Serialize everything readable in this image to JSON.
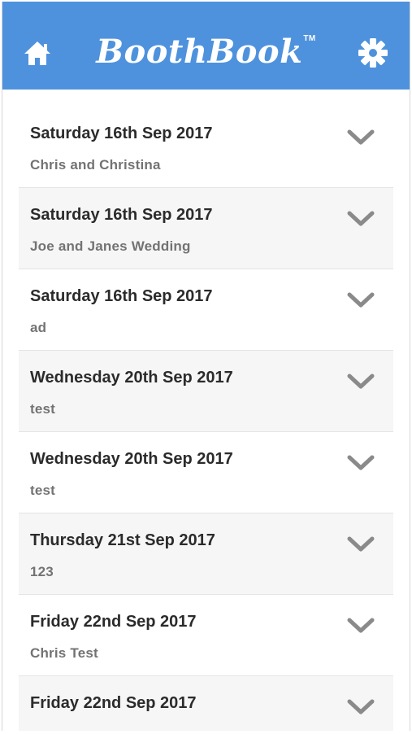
{
  "app": {
    "brand": "BoothBook",
    "trademark": "TM"
  },
  "icons": {
    "home": "home-icon",
    "settings": "gear-icon",
    "expand": "chevron-down-icon"
  },
  "colors": {
    "header_bg": "#4e92dd",
    "alt_row_bg": "#f6f6f6",
    "chevron": "#8a8a8a"
  },
  "bookings": [
    {
      "date": "Saturday 16th Sep 2017",
      "name": "Chris and Christina"
    },
    {
      "date": "Saturday 16th Sep 2017",
      "name": "Joe and Janes Wedding"
    },
    {
      "date": "Saturday 16th Sep 2017",
      "name": "ad"
    },
    {
      "date": "Wednesday 20th Sep 2017",
      "name": "test"
    },
    {
      "date": "Wednesday 20th Sep 2017",
      "name": "test"
    },
    {
      "date": "Thursday 21st Sep 2017",
      "name": "123"
    },
    {
      "date": "Friday 22nd Sep 2017",
      "name": "Chris Test"
    },
    {
      "date": "Friday 22nd Sep 2017",
      "name": ""
    }
  ]
}
